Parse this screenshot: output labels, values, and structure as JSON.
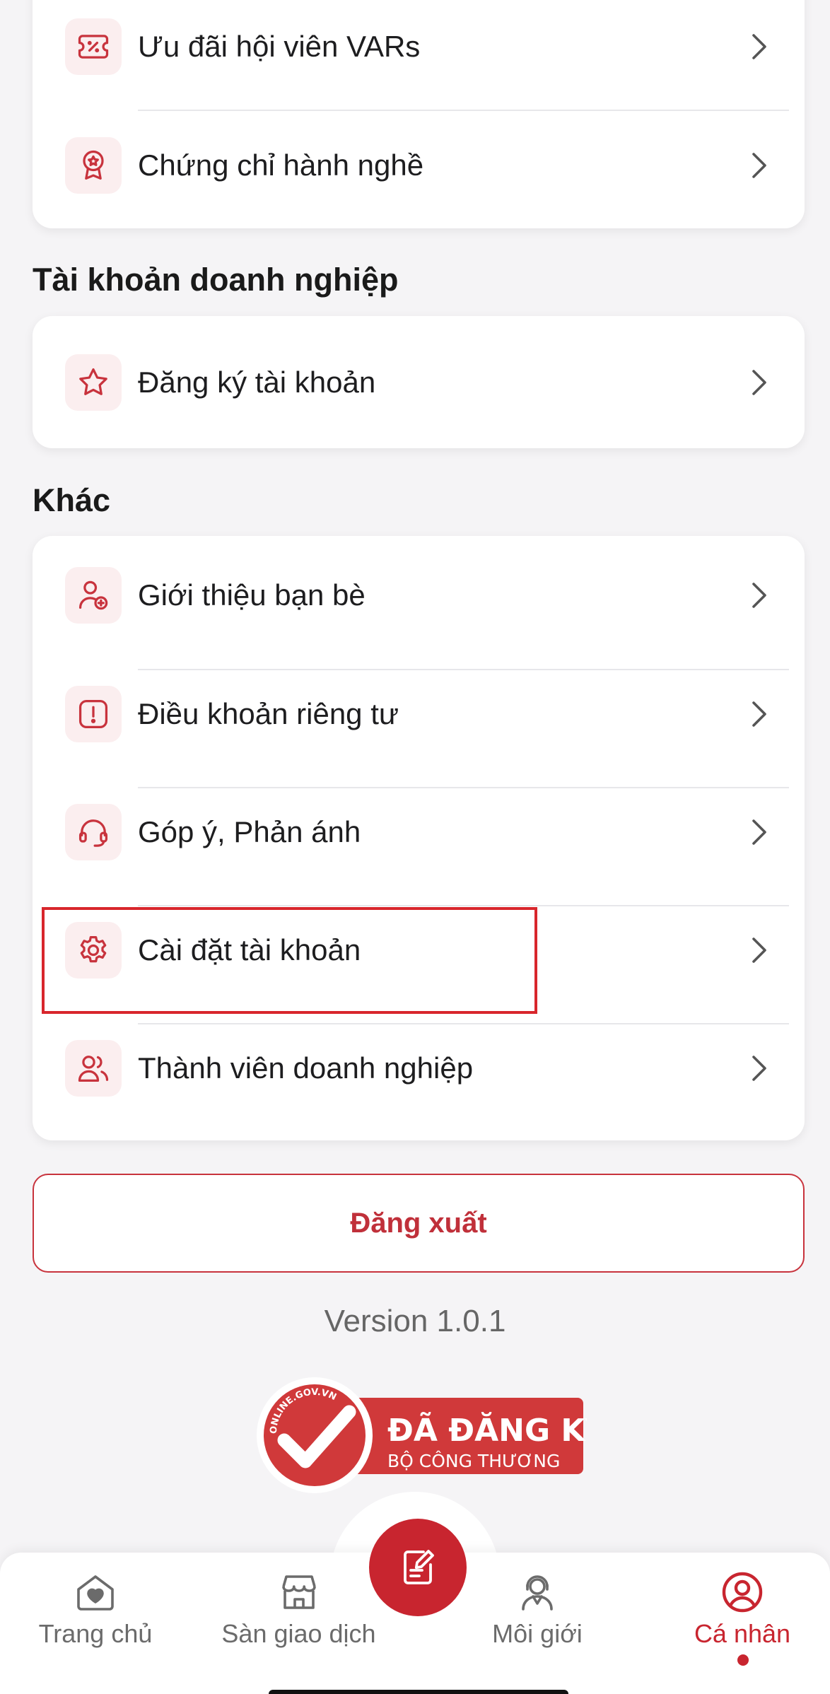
{
  "colors": {
    "accent": "#c8252f",
    "icon_bg": "#fbeeef",
    "background": "#f5f4f6"
  },
  "top_group": {
    "items": [
      {
        "label": "Ưu đãi hội viên VARs",
        "icon": "discount-ticket-icon"
      },
      {
        "label": "Chứng chỉ hành nghề",
        "icon": "certificate-badge-icon"
      }
    ]
  },
  "business_account": {
    "title": "Tài khoản doanh nghiệp",
    "items": [
      {
        "label": "Đăng ký tài khoản",
        "icon": "star-icon"
      }
    ]
  },
  "other": {
    "title": "Khác",
    "items": [
      {
        "label": "Giới thiệu bạn bè",
        "icon": "user-add-icon"
      },
      {
        "label": "Điều khoản riêng tư",
        "icon": "alert-icon"
      },
      {
        "label": "Góp ý, Phản ánh",
        "icon": "headset-icon"
      },
      {
        "label": "Cài đặt tài khoản",
        "icon": "gear-icon"
      },
      {
        "label": "Thành viên doanh nghiệp",
        "icon": "users-icon"
      }
    ]
  },
  "logout_label": "Đăng xuất",
  "version": "Version 1.0.1",
  "badge": {
    "seal_text": "ONLINE.GOV.VN",
    "line1": "ĐÃ ĐĂNG KÝ",
    "line2": "BỘ CÔNG THƯƠNG"
  },
  "nav": {
    "items": [
      {
        "label": "Trang chủ",
        "icon": "home-heart-icon"
      },
      {
        "label": "Sàn giao dịch",
        "icon": "store-icon"
      },
      {
        "label": "",
        "icon": "edit-note-icon"
      },
      {
        "label": "Môi giới",
        "icon": "broker-icon"
      },
      {
        "label": "Cá nhân",
        "icon": "profile-icon",
        "active": true
      }
    ]
  }
}
